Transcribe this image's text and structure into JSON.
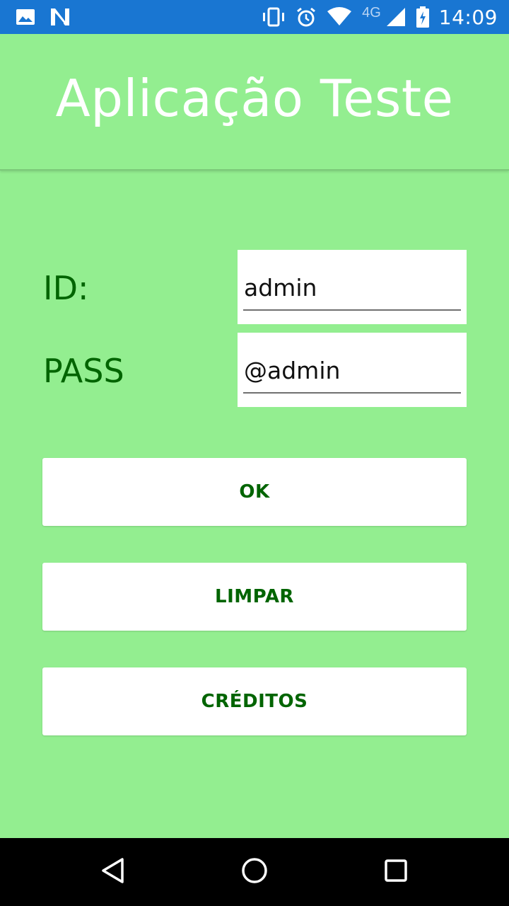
{
  "status_bar": {
    "network_type": "4G",
    "time": "14:09",
    "icons_left": [
      "image-icon",
      "n-notification-icon"
    ],
    "icons_right": [
      "vibrate-icon",
      "alarm-icon",
      "wifi-icon",
      "signal-icon",
      "battery-icon"
    ]
  },
  "app_bar": {
    "title": "Aplicação Teste"
  },
  "form": {
    "id_label": "ID:",
    "id_value": "admin",
    "pass_label": "PASS",
    "pass_value": "@admin"
  },
  "buttons": {
    "ok_label": "OK",
    "clear_label": "LIMPAR",
    "credits_label": "CRÉDITOS"
  },
  "nav_bar": {
    "icons": [
      "back-icon",
      "home-icon",
      "recents-icon"
    ]
  },
  "colors": {
    "status_bar": "#1976d2",
    "background": "#93ee90",
    "label_text": "#006400",
    "button_bg": "#ffffff",
    "nav_bar": "#000000"
  }
}
